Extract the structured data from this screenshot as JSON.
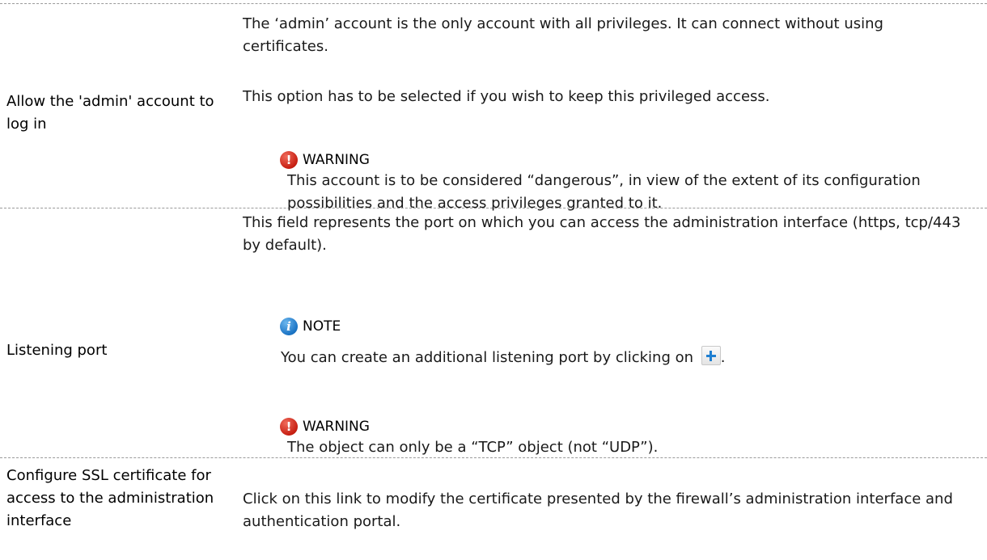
{
  "rows": [
    {
      "label": "Allow the 'admin' account to log in",
      "paragraphs": [
        "The ‘admin’ account is the only account with all privileges. It can connect without using certificates.",
        "This option has to be selected if you wish to keep this privileged access."
      ],
      "warning": {
        "title": "WARNING",
        "text": "This account is to be considered “dangerous”, in view of the extent of its configuration possibilities and the access privileges granted to it."
      }
    },
    {
      "label": "Listening port",
      "paragraphs": [
        "This field represents the port on which you can access the administration interface (https, tcp/443 by default)."
      ],
      "note": {
        "title": "NOTE",
        "text_before_icon": "You can create an additional listening port by clicking on",
        "text_after_icon": ".",
        "inline_icon": "add-plus-icon"
      },
      "warning": {
        "title": "WARNING",
        "text": "The object can only be a “TCP” object (not “UDP”)."
      }
    },
    {
      "label": "Configure SSL certificate for access to the administration interface",
      "paragraphs": [
        "Click on this link to modify the certificate presented by the firewall’s administration interface and authentication portal."
      ]
    }
  ],
  "icons": {
    "warning": "warning-icon",
    "note": "info-icon"
  },
  "colors": {
    "warning_icon": "#c71f12",
    "note_icon": "#1a73c4",
    "divider": "#9a9a9a"
  }
}
